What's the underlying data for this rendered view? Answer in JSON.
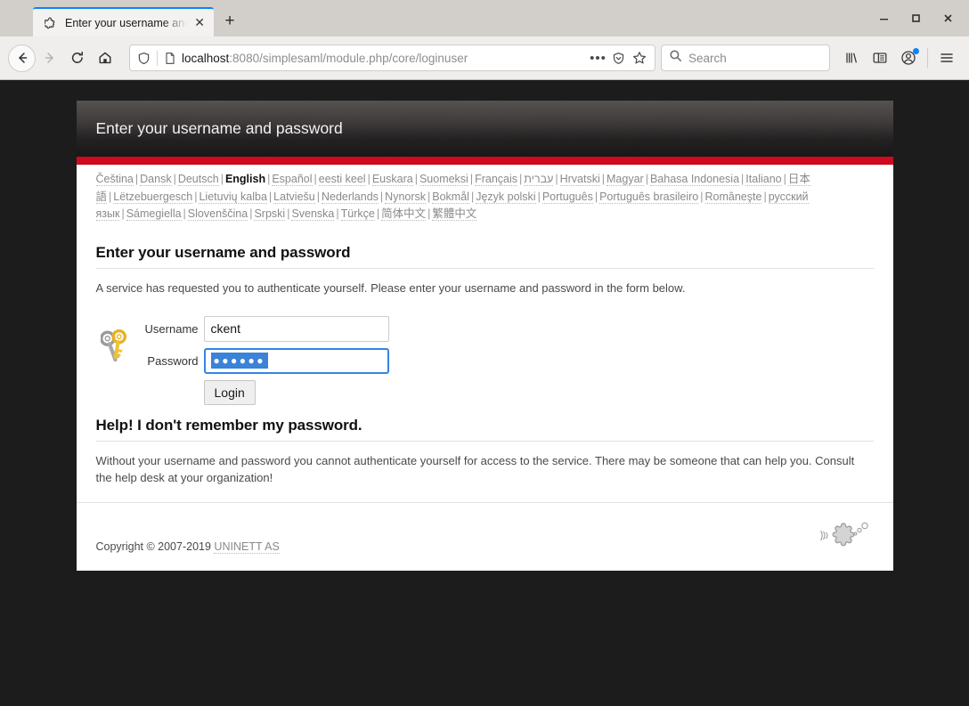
{
  "browser": {
    "tab": {
      "title": "Enter your username and",
      "favicon_name": "simplesamlphp-puzzle-favicon",
      "close_label": "✕"
    },
    "newtab_label": "+",
    "window_controls": {
      "minimize": "—",
      "maximize": "□",
      "close": "✕"
    },
    "nav": {
      "back": "back-arrow",
      "forward": "forward-arrow",
      "reload": "reload-arrow",
      "home": "home-house"
    },
    "url": {
      "host": "localhost",
      "path": ":8080/simplesaml/module.php/core/loginuser",
      "full": "localhost:8080/simplesaml/module.php/core/loginuser"
    },
    "url_actions": {
      "page_actions": "•••",
      "pocket": "pocket-shield",
      "bookmark": "star-outline"
    },
    "search": {
      "placeholder": "Search"
    },
    "toolbar_icons": {
      "library": "library-books",
      "sidebar": "sidebar-panel",
      "account": "account-avatar",
      "menu": "hamburger-menu"
    }
  },
  "page": {
    "header_title": "Enter your username and password",
    "languages": [
      {
        "label": "Čeština",
        "current": false
      },
      {
        "label": "Dansk",
        "current": false
      },
      {
        "label": "Deutsch",
        "current": false
      },
      {
        "label": "English",
        "current": true
      },
      {
        "label": "Español",
        "current": false
      },
      {
        "label": "eesti keel",
        "current": false
      },
      {
        "label": "Euskara",
        "current": false
      },
      {
        "label": "Suomeksi",
        "current": false
      },
      {
        "label": "Français",
        "current": false
      },
      {
        "label": "עברית",
        "current": false
      },
      {
        "label": "Hrvatski",
        "current": false
      },
      {
        "label": "Magyar",
        "current": false
      },
      {
        "label": "Bahasa Indonesia",
        "current": false
      },
      {
        "label": "Italiano",
        "current": false
      },
      {
        "label": "日本語",
        "current": false
      },
      {
        "label": "Lëtzebuergesch",
        "current": false
      },
      {
        "label": "Lietuvių kalba",
        "current": false
      },
      {
        "label": "Latviešu",
        "current": false
      },
      {
        "label": "Nederlands",
        "current": false
      },
      {
        "label": "Nynorsk",
        "current": false
      },
      {
        "label": "Bokmål",
        "current": false
      },
      {
        "label": "Język polski",
        "current": false
      },
      {
        "label": "Português",
        "current": false
      },
      {
        "label": "Português brasileiro",
        "current": false
      },
      {
        "label": "Româneşte",
        "current": false
      },
      {
        "label": "русский язык",
        "current": false
      },
      {
        "label": "Sámegiella",
        "current": false
      },
      {
        "label": "Slovenščina",
        "current": false
      },
      {
        "label": "Srpski",
        "current": false
      },
      {
        "label": "Svenska",
        "current": false
      },
      {
        "label": "Türkçe",
        "current": false
      },
      {
        "label": "简体中文",
        "current": false
      },
      {
        "label": "繁體中文",
        "current": false
      }
    ],
    "login": {
      "heading": "Enter your username and password",
      "intro": "A service has requested you to authenticate yourself. Please enter your username and password in the form below.",
      "key_icon": "keys-icon",
      "username_label": "Username",
      "username_value": "ckent",
      "password_label": "Password",
      "password_value": "●●●●●●",
      "submit_label": "Login"
    },
    "help": {
      "heading": "Help! I don't remember my password.",
      "body": "Without your username and password you cannot authenticate yourself for access to the service. There may be someone that can help you. Consult the help desk at your organization!"
    },
    "footer": {
      "copyright": "Copyright © 2007-2019",
      "org_link": "UNINETT AS",
      "logo_name": "uninett-puzzle-logo"
    }
  },
  "colors": {
    "accent_red": "#cf0a1e",
    "tab_accent": "#0a84ff",
    "selection_blue": "#3b82d9",
    "focus_blue": "#3584e4",
    "page_background": "#1c1c1c"
  }
}
